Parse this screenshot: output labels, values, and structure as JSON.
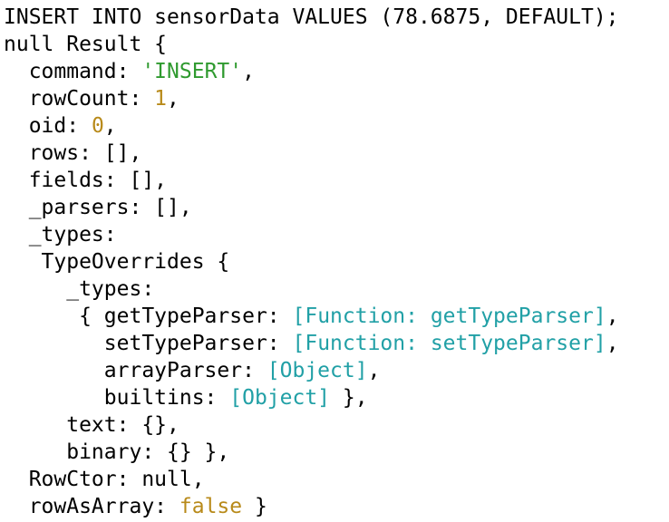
{
  "terminal": {
    "colors": {
      "background": "#ffffff",
      "text": "#000000",
      "string": "#2f9a2f",
      "number": "#b88a1a",
      "special": "#21a0a6"
    },
    "lines": [
      [
        {
          "text": "INSERT INTO sensorData VALUES (78.6875, DEFAULT);",
          "type": "plain"
        }
      ],
      [
        {
          "text": "null Result {",
          "type": "plain"
        }
      ],
      [
        {
          "text": "  command: ",
          "type": "plain"
        },
        {
          "text": "'INSERT'",
          "type": "string"
        },
        {
          "text": ",",
          "type": "plain"
        }
      ],
      [
        {
          "text": "  rowCount: ",
          "type": "plain"
        },
        {
          "text": "1",
          "type": "number"
        },
        {
          "text": ",",
          "type": "plain"
        }
      ],
      [
        {
          "text": "  oid: ",
          "type": "plain"
        },
        {
          "text": "0",
          "type": "number"
        },
        {
          "text": ",",
          "type": "plain"
        }
      ],
      [
        {
          "text": "  rows: [],",
          "type": "plain"
        }
      ],
      [
        {
          "text": "  fields: [],",
          "type": "plain"
        }
      ],
      [
        {
          "text": "  _parsers: [],",
          "type": "plain"
        }
      ],
      [
        {
          "text": "  _types:",
          "type": "plain"
        }
      ],
      [
        {
          "text": "   TypeOverrides {",
          "type": "plain"
        }
      ],
      [
        {
          "text": "     _types:",
          "type": "plain"
        }
      ],
      [
        {
          "text": "      { getTypeParser: ",
          "type": "plain"
        },
        {
          "text": "[Function: getTypeParser]",
          "type": "special"
        },
        {
          "text": ",",
          "type": "plain"
        }
      ],
      [
        {
          "text": "        setTypeParser: ",
          "type": "plain"
        },
        {
          "text": "[Function: setTypeParser]",
          "type": "special"
        },
        {
          "text": ",",
          "type": "plain"
        }
      ],
      [
        {
          "text": "        arrayParser: ",
          "type": "plain"
        },
        {
          "text": "[Object]",
          "type": "special"
        },
        {
          "text": ",",
          "type": "plain"
        }
      ],
      [
        {
          "text": "        builtins: ",
          "type": "plain"
        },
        {
          "text": "[Object]",
          "type": "special"
        },
        {
          "text": " },",
          "type": "plain"
        }
      ],
      [
        {
          "text": "     text: {},",
          "type": "plain"
        }
      ],
      [
        {
          "text": "     binary: {} },",
          "type": "plain"
        }
      ],
      [
        {
          "text": "  RowCtor: null,",
          "type": "plain"
        }
      ],
      [
        {
          "text": "  rowAsArray: ",
          "type": "plain"
        },
        {
          "text": "false",
          "type": "boolean"
        },
        {
          "text": " }",
          "type": "plain"
        }
      ]
    ]
  }
}
